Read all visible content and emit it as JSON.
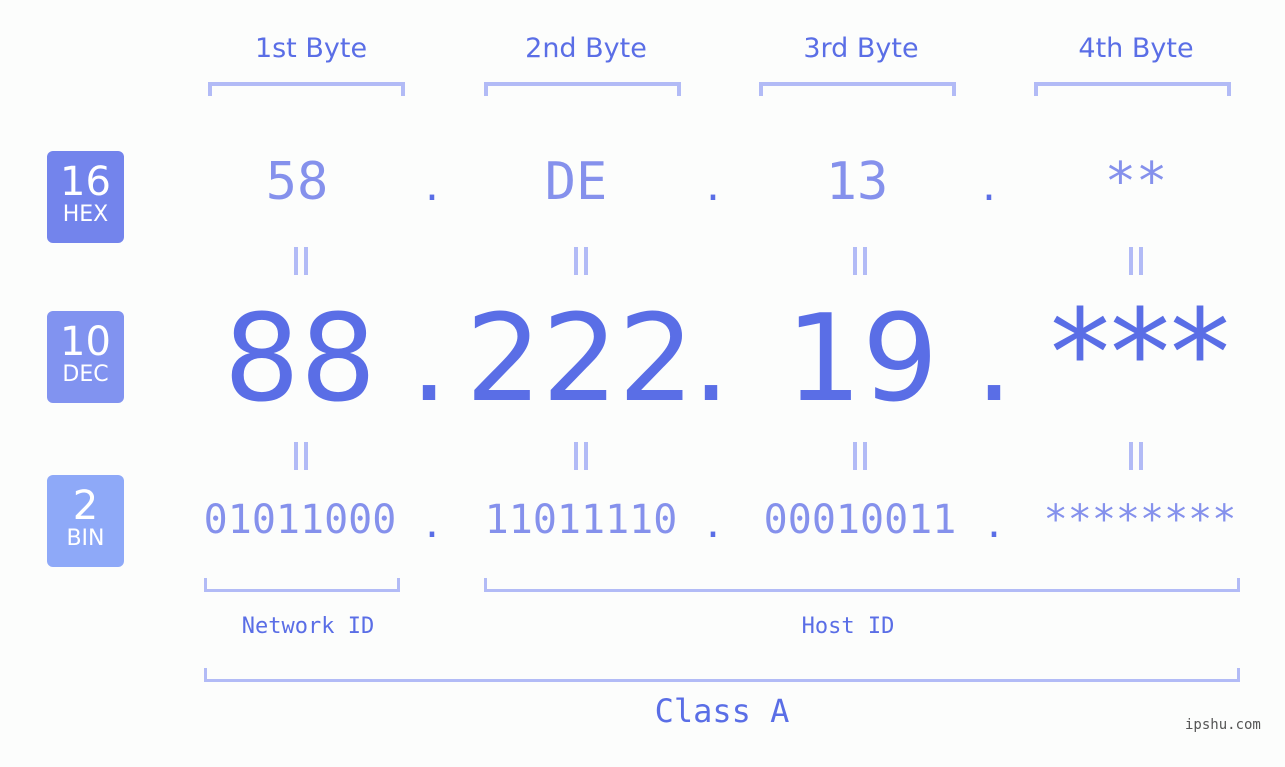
{
  "bytes": {
    "labels": [
      "1st Byte",
      "2nd Byte",
      "3rd Byte",
      "4th Byte"
    ]
  },
  "badges": {
    "hex": {
      "number": "16",
      "label": "HEX",
      "color": "#7384ec"
    },
    "dec": {
      "number": "10",
      "label": "DEC",
      "color": "#8193f0"
    },
    "bin": {
      "number": "2",
      "label": "BIN",
      "color": "#8ea9f8"
    }
  },
  "ip": {
    "hex": [
      "58",
      "DE",
      "13",
      "**"
    ],
    "dec": [
      "88",
      "222",
      "19",
      "***"
    ],
    "bin": [
      "01011000",
      "11011110",
      "00010011",
      "********"
    ],
    "separator": ".",
    "equals": "="
  },
  "sections": {
    "network_id": "Network ID",
    "host_id": "Host ID",
    "class": "Class A"
  },
  "colors": {
    "primary": "#5a6ee6",
    "secondary": "#8591ec",
    "bracket": "#b2bbf6",
    "background": "#fcfdfc"
  },
  "watermark": "ipshu.com"
}
